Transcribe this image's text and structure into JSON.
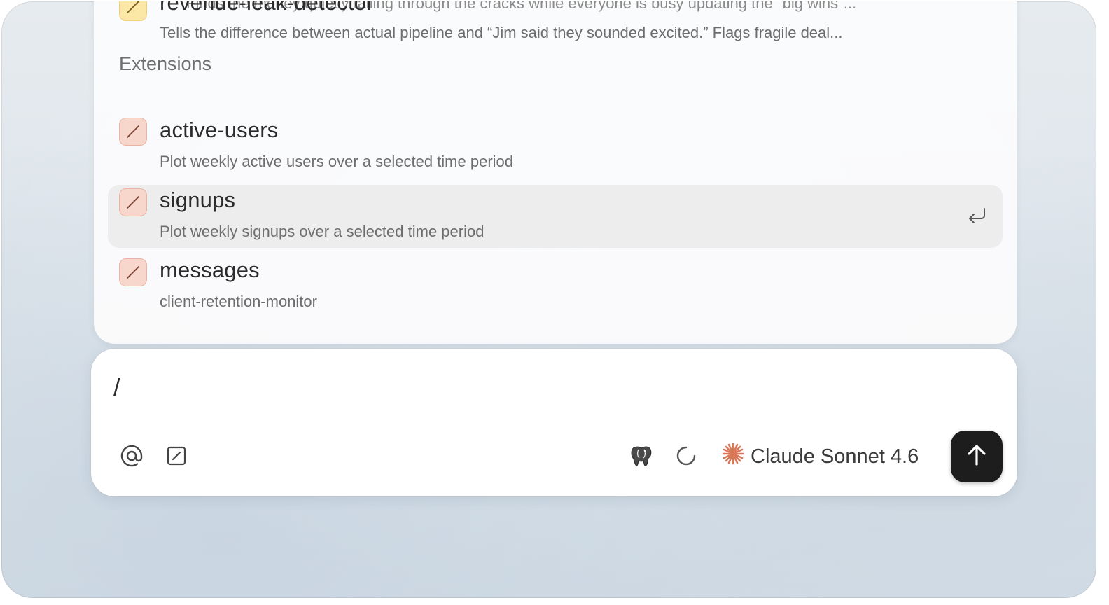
{
  "palette": {
    "cut_row_text": "Finds the money quietly falling through the cracks while everyone is busy updating the \"big wins\"...",
    "items": [
      {
        "name": "revenue-leak-detector",
        "description": "Tells the difference between actual pipeline and “Jim said they sounded excited.” Flags fragile deal...",
        "icon": "slash-command-icon",
        "color": "#fbe7a6"
      }
    ],
    "section_label": "Extensions",
    "extensions": [
      {
        "name": "active-users",
        "description": "Plot weekly active users over a selected time period",
        "icon": "slash-command-icon",
        "color": "#f7d6cc"
      },
      {
        "name": "signups",
        "description": "Plot weekly signups over a selected time period",
        "icon": "slash-command-icon",
        "color": "#f7d6cc",
        "selected": true
      },
      {
        "name": "messages",
        "description": "client-retention-monitor",
        "icon": "slash-command-icon",
        "color": "#f7d6cc"
      }
    ],
    "enter_icon": "enter-return-icon"
  },
  "composer": {
    "input_value": "/",
    "tools": [
      "at-mention-icon",
      "slash-command-icon"
    ],
    "right_tools": [
      "postgres-elephant-icon",
      "loading-spinner-icon"
    ],
    "model_icon": "claude-asterisk-icon",
    "model_name": "Claude Sonnet 4.6",
    "model_accent": "#d97757",
    "send_icon": "arrow-up-icon"
  }
}
